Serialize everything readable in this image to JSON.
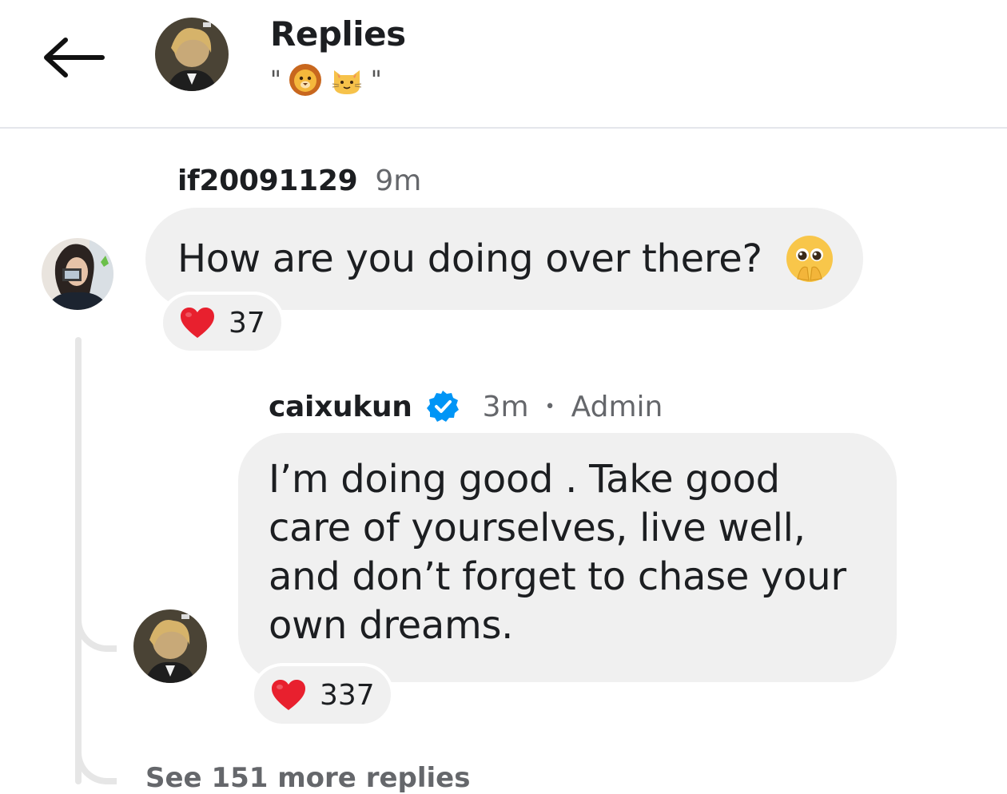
{
  "header": {
    "title": "Replies",
    "subtitle_open_quote": "\"",
    "subtitle_close_quote": "\"",
    "subtitle_emojis": [
      "lion-face-emoji",
      "cat-face-emoji"
    ],
    "back_icon": "arrow-left-icon"
  },
  "comments": [
    {
      "username": "if20091129",
      "time": "9m",
      "text": "How are you doing over there?",
      "emoji": "pleading-face-emoji",
      "reaction": {
        "icon": "red-heart-icon",
        "count": "37"
      }
    },
    {
      "username": "caixukun",
      "verified": true,
      "time": "3m",
      "separator": "•",
      "role": "Admin",
      "text": "I’m doing good . Take good\ncare of yourselves, live well,\nand don’t forget to chase your\nown dreams.",
      "reaction": {
        "icon": "red-heart-icon",
        "count": "337"
      }
    }
  ],
  "see_more": "See 151 more replies",
  "colors": {
    "bubble": "#f0f0f0",
    "text": "#1c1e21",
    "secondary": "#65676b",
    "verified": "#0095f6",
    "heart": "#e8202e",
    "thread_line": "#e6e6e6"
  }
}
